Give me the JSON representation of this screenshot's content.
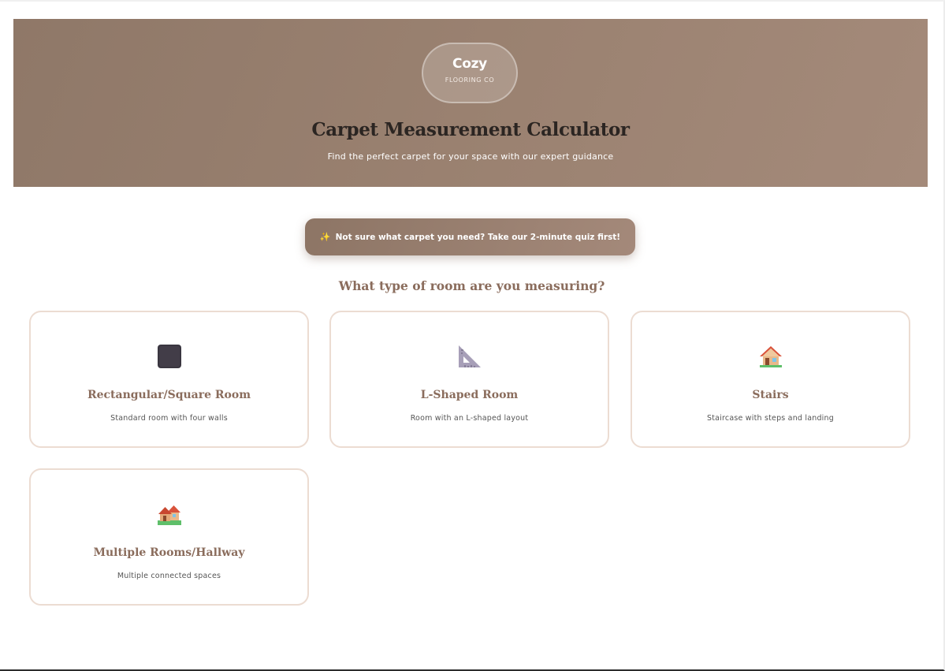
{
  "brand": {
    "name": "Cozy",
    "tagline": "FLOORING CO"
  },
  "hero": {
    "title": "Carpet Measurement Calculator",
    "subtitle": "Find the perfect carpet for your space with our expert guidance"
  },
  "quiz": {
    "icon": "sparkles-icon",
    "label": "Not sure what carpet you need? Take our 2-minute quiz first!"
  },
  "section": {
    "heading": "What type of room are you measuring?"
  },
  "room_types": [
    {
      "icon": "square-icon",
      "title": "Rectangular/Square Room",
      "description": "Standard room with four walls"
    },
    {
      "icon": "triangle-ruler-icon",
      "title": "L-Shaped Room",
      "description": "Room with an L-shaped layout"
    },
    {
      "icon": "house-icon",
      "title": "Stairs",
      "description": "Staircase with steps and landing"
    },
    {
      "icon": "houses-icon",
      "title": "Multiple Rooms/Hallway",
      "description": "Multiple connected spaces"
    }
  ],
  "colors": {
    "hero_start": "#8f7868",
    "hero_end": "#a48a7a",
    "accent_text": "#8a6c5c",
    "card_border": "#ecdcd2"
  }
}
